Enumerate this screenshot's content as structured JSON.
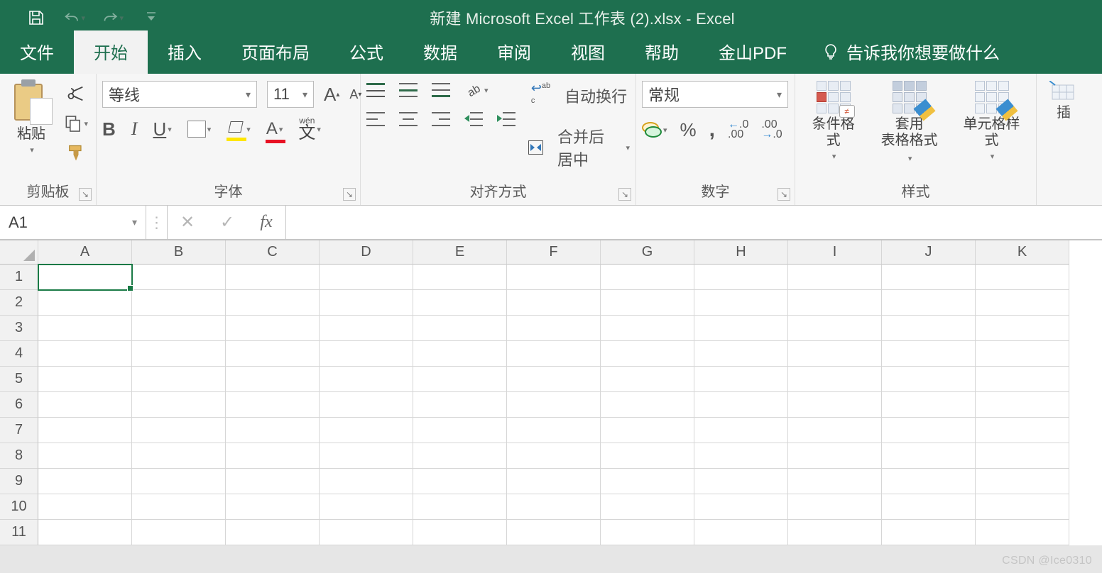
{
  "colors": {
    "accent": "#1e6f4f"
  },
  "title": "新建 Microsoft Excel 工作表 (2).xlsx  -  Excel",
  "tabs": {
    "items": [
      "文件",
      "开始",
      "插入",
      "页面布局",
      "公式",
      "数据",
      "审阅",
      "视图",
      "帮助",
      "金山PDF"
    ],
    "active_index": 1,
    "tellme": "告诉我你想要做什么"
  },
  "ribbon": {
    "clipboard": {
      "paste": "粘贴",
      "label": "剪贴板"
    },
    "font": {
      "name": "等线",
      "size": "11",
      "label": "字体"
    },
    "alignment": {
      "wrap": "自动换行",
      "merge": "合并后居中",
      "label": "对齐方式"
    },
    "number": {
      "format": "常规",
      "percent": "%",
      "comma": ",",
      "label": "数字",
      "dec_inc": ".00",
      "dec_inc_sub": ".0",
      "dec_dec": ".0",
      "dec_dec_sub": ".00"
    },
    "styles": {
      "cond": "条件格式",
      "table_l1": "套用",
      "table_l2": "表格格式",
      "cell": "单元格样式",
      "label": "样式"
    },
    "insert_trunc": "插"
  },
  "formula_bar": {
    "name_box": "A1",
    "fx": "fx",
    "value": ""
  },
  "grid": {
    "columns": [
      "A",
      "B",
      "C",
      "D",
      "E",
      "F",
      "G",
      "H",
      "I",
      "J",
      "K"
    ],
    "rows": [
      "1",
      "2",
      "3",
      "4",
      "5",
      "6",
      "7",
      "8",
      "9",
      "10",
      "11"
    ],
    "selected": {
      "row": 0,
      "col": 0
    }
  },
  "watermark": "CSDN @Ice0310"
}
